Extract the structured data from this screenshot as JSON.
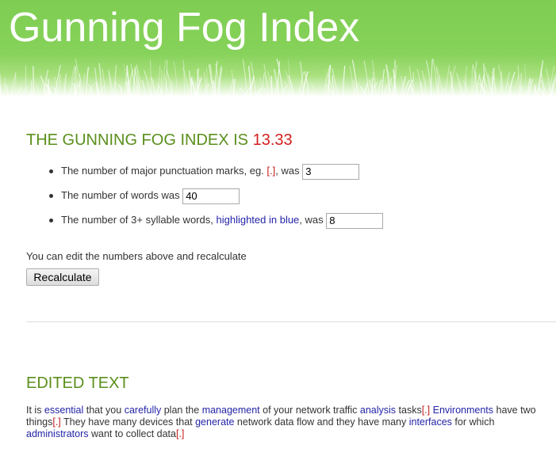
{
  "header": {
    "title": "Gunning Fog Index"
  },
  "result": {
    "heading_prefix": "THE GUNNING FOG INDEX IS",
    "score": "13.33"
  },
  "metrics": {
    "punctuation": {
      "label_before": "The number of major punctuation marks, eg.",
      "mark": "[.]",
      "label_after": ", was",
      "value": "3"
    },
    "words": {
      "label": "The number of words was",
      "value": "40"
    },
    "syllables": {
      "label_before": "The number of 3+ syllable words,",
      "highlight": "highlighted in blue",
      "label_after": ", was",
      "value": "8"
    }
  },
  "edit_note": "You can edit the numbers above and recalculate",
  "recalculate_label": "Recalculate",
  "edited": {
    "heading": "EDITED TEXT",
    "segments": [
      {
        "text": "It is ",
        "kind": "plain"
      },
      {
        "text": "essential",
        "kind": "hl"
      },
      {
        "text": " that you ",
        "kind": "plain"
      },
      {
        "text": "carefully",
        "kind": "hl"
      },
      {
        "text": " plan the ",
        "kind": "plain"
      },
      {
        "text": "management",
        "kind": "hl"
      },
      {
        "text": " of your network traffic ",
        "kind": "plain"
      },
      {
        "text": "analysis",
        "kind": "hl"
      },
      {
        "text": " tasks",
        "kind": "plain"
      },
      {
        "text": "[.]",
        "kind": "punct"
      },
      {
        "text": " ",
        "kind": "plain"
      },
      {
        "text": "Environments",
        "kind": "hl"
      },
      {
        "text": " have two things",
        "kind": "plain"
      },
      {
        "text": "[.]",
        "kind": "punct"
      },
      {
        "text": " They have many devices that ",
        "kind": "plain"
      },
      {
        "text": "generate",
        "kind": "hl"
      },
      {
        "text": " network data flow and they have many ",
        "kind": "plain"
      },
      {
        "text": "interfaces",
        "kind": "hl"
      },
      {
        "text": " for which ",
        "kind": "plain"
      },
      {
        "text": "administrators",
        "kind": "hl"
      },
      {
        "text": " want to collect data",
        "kind": "plain"
      },
      {
        "text": "[.]",
        "kind": "punct"
      }
    ]
  },
  "colors": {
    "header_green": "#86d25a",
    "heading_green": "#5a8f1b",
    "score_red": "#d42020",
    "highlight_blue": "#2424a8",
    "punct_red": "#c41a1a"
  }
}
